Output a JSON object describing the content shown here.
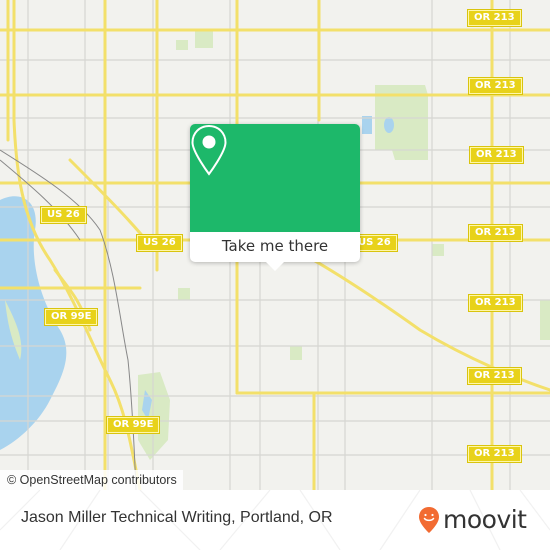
{
  "map": {
    "attribution": "© OpenStreetMap contributors",
    "colors": {
      "land": "#f2f2ee",
      "water": "#a9d3ee",
      "park": "#d9eac4",
      "major_road": "#f3e06a",
      "minor_road": "#d6d6d2",
      "rail": "#888888",
      "shield": "#e8d21a"
    },
    "shields": [
      {
        "label": "OR 213"
      },
      {
        "label": "OR 213"
      },
      {
        "label": "OR 213"
      },
      {
        "label": "OR 213"
      },
      {
        "label": "OR 213"
      },
      {
        "label": "OR 213"
      },
      {
        "label": "OR 213"
      },
      {
        "label": "US 26"
      },
      {
        "label": "US 26"
      },
      {
        "label": "US 26"
      },
      {
        "label": "OR 99E"
      },
      {
        "label": "OR 99E"
      }
    ]
  },
  "popup": {
    "icon": "map-pin-icon",
    "button_label": "Take me there",
    "accent_color": "#1db86a"
  },
  "footer": {
    "place_title": "Jason Miller Technical Writing, Portland, OR",
    "brand": "moovit",
    "brand_icon": "moovit-smile-pin-icon",
    "brand_color": "#f26b32"
  }
}
